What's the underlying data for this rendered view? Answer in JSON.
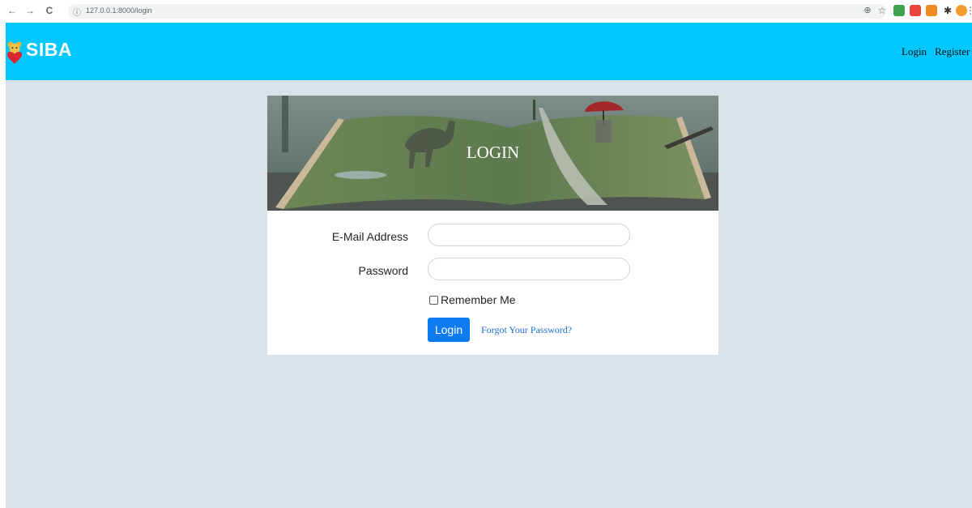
{
  "browser": {
    "url": "127.0.0.1:8000/login",
    "back_glyph": "←",
    "forward_glyph": "→",
    "reload_glyph": "C",
    "info_glyph": "ⓘ",
    "zoom_glyph": "⊕",
    "star_glyph": "☆",
    "menu_glyph": "⋮",
    "extensions": [
      "extension-green-icon",
      "extension-red-icon",
      "metamask-icon",
      "puzzle-icon",
      "profile-avatar-icon"
    ]
  },
  "navbar": {
    "brand": "SIBA",
    "links": [
      "Login",
      "Register"
    ],
    "color": "#00c8ff"
  },
  "login_card": {
    "hero_title": "LOGIN",
    "email_label": "E-Mail Address",
    "email_value": "",
    "password_label": "Password",
    "password_value": "",
    "remember_label": "Remember Me",
    "remember_checked": false,
    "submit_label": "Login",
    "forgot_label": "Forgot Your Password?"
  },
  "colors": {
    "page_bg": "#d8e2e8",
    "button": "#0d7bf2",
    "link": "#1a6fd6"
  }
}
